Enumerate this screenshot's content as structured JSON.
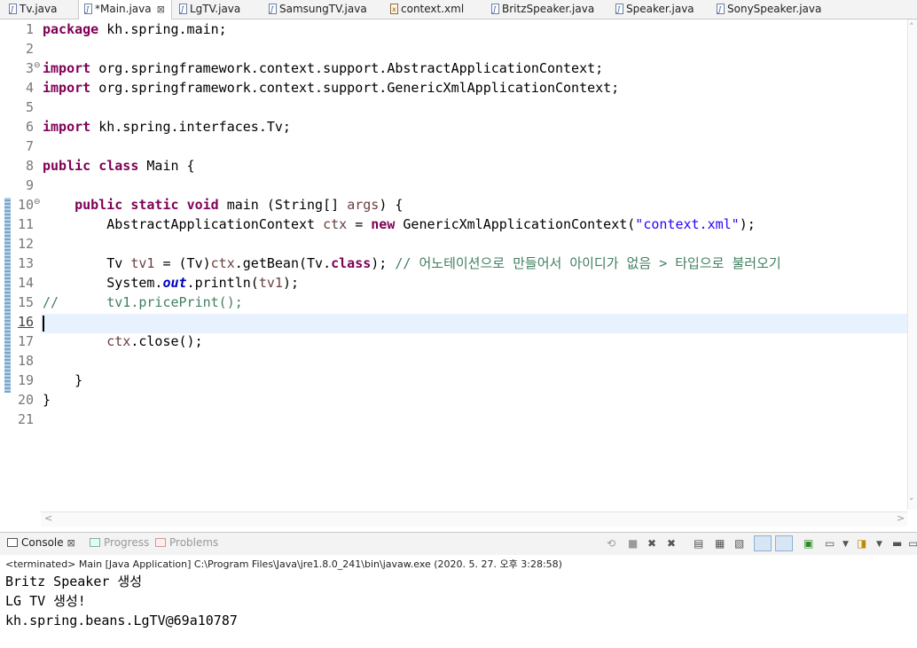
{
  "tabs": [
    {
      "label": "Tv.java",
      "kind": "java"
    },
    {
      "label": "*Main.java",
      "kind": "java",
      "active": true,
      "close": "⊠"
    },
    {
      "label": "LgTV.java",
      "kind": "java"
    },
    {
      "label": "SamsungTV.java",
      "kind": "java"
    },
    {
      "label": "context.xml",
      "kind": "xml"
    },
    {
      "label": "BritzSpeaker.java",
      "kind": "java"
    },
    {
      "label": "Speaker.java",
      "kind": "java"
    },
    {
      "label": "SonySpeaker.java",
      "kind": "java"
    }
  ],
  "editor": {
    "line_numbers": [
      "1",
      "2",
      "3",
      "4",
      "5",
      "6",
      "7",
      "8",
      "9",
      "10",
      "11",
      "12",
      "13",
      "14",
      "15",
      "16",
      "17",
      "18",
      "19",
      "20",
      "21"
    ],
    "current_line": "16",
    "fold_markers": {
      "3": "⊖",
      "10": "⊖"
    },
    "lines": [
      [
        {
          "t": "package",
          "c": "kw"
        },
        {
          "t": " kh.spring.main;"
        }
      ],
      [],
      [
        {
          "t": "import",
          "c": "kw"
        },
        {
          "t": " org.springframework.context.support.AbstractApplicationContext;"
        }
      ],
      [
        {
          "t": "import",
          "c": "kw"
        },
        {
          "t": " org.springframework.context.support.GenericXmlApplicationContext;"
        }
      ],
      [],
      [
        {
          "t": "import",
          "c": "kw"
        },
        {
          "t": " kh.spring.interfaces.Tv;"
        }
      ],
      [],
      [
        {
          "t": "public",
          "c": "kw"
        },
        {
          "t": " "
        },
        {
          "t": "class",
          "c": "kw"
        },
        {
          "t": " Main {"
        }
      ],
      [],
      [
        {
          "t": "    "
        },
        {
          "t": "public",
          "c": "kw"
        },
        {
          "t": " "
        },
        {
          "t": "static",
          "c": "kw"
        },
        {
          "t": " "
        },
        {
          "t": "void",
          "c": "kw"
        },
        {
          "t": " main (String[] "
        },
        {
          "t": "args",
          "c": "lv"
        },
        {
          "t": ") {"
        }
      ],
      [
        {
          "t": "        AbstractApplicationContext "
        },
        {
          "t": "ctx",
          "c": "lv"
        },
        {
          "t": " = "
        },
        {
          "t": "new",
          "c": "kw"
        },
        {
          "t": " GenericXmlApplicationContext("
        },
        {
          "t": "\"context.xml\"",
          "c": "str"
        },
        {
          "t": ");"
        }
      ],
      [],
      [
        {
          "t": "        Tv "
        },
        {
          "t": "tv1",
          "c": "lv"
        },
        {
          "t": " = (Tv)"
        },
        {
          "t": "ctx",
          "c": "lv"
        },
        {
          "t": ".getBean(Tv."
        },
        {
          "t": "class",
          "c": "kw"
        },
        {
          "t": "); "
        },
        {
          "t": "// 어노테이션으로 만들어서 아이디가 없음 > 타입으로 불러오기",
          "c": "cmt"
        }
      ],
      [
        {
          "t": "        System."
        },
        {
          "t": "out",
          "c": "fld"
        },
        {
          "t": ".println("
        },
        {
          "t": "tv1",
          "c": "lv"
        },
        {
          "t": ");"
        }
      ],
      [
        {
          "t": "//      tv1.pricePrint();",
          "c": "cmt"
        }
      ],
      [],
      [
        {
          "t": "        "
        },
        {
          "t": "ctx",
          "c": "lv"
        },
        {
          "t": ".close();"
        }
      ],
      [],
      [
        {
          "t": "    }"
        }
      ],
      [
        {
          "t": "}"
        }
      ],
      []
    ]
  },
  "console": {
    "tabs": [
      {
        "label": "Console",
        "close": "⊠",
        "active": true
      },
      {
        "label": "Progress",
        "active": false
      },
      {
        "label": "Problems",
        "active": false
      }
    ],
    "status": "<terminated> Main [Java Application] C:\\Program Files\\Java\\jre1.8.0_241\\bin\\javaw.exe (2020. 5. 27. 오후 3:28:58)",
    "output": [
      "Britz Speaker 생성",
      "LG TV 생성!",
      "kh.spring.beans.LgTV@69a10787"
    ]
  }
}
